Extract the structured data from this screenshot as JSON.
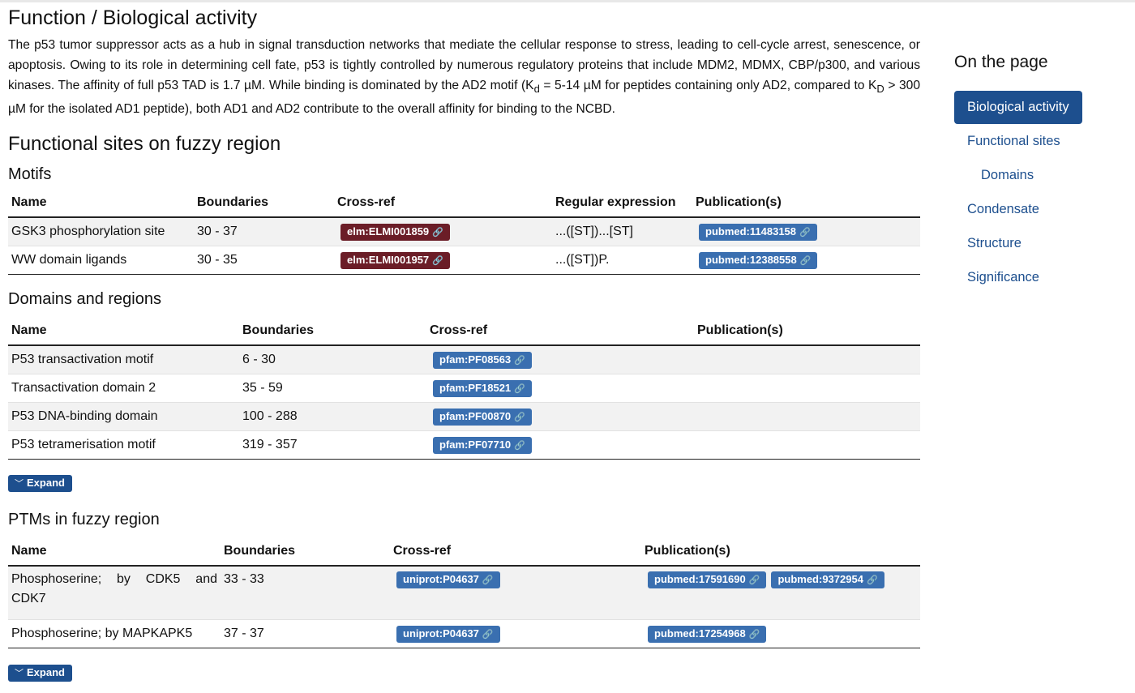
{
  "header": {
    "title": "Function / Biological activity"
  },
  "intro": {
    "part1": "The p53 tumor suppressor acts as a hub in signal transduction networks that mediate the cellular response to stress, leading to cell-cycle arrest, senescence, or apoptosis. Owing to its role in determining cell fate, p53 is tightly controlled by numerous regulatory proteins that include MDM2, MDMX, CBP/p300, and various kinases. The affinity of full p53 TAD is 1.7 µM. While binding is dominated by the AD2 motif (K",
    "sub1": "d",
    "part2": " = 5-14 µM for peptides containing only AD2, compared to K",
    "sub2": "D",
    "part3": " > 300 µM for the isolated AD1 peptide), both AD1 and AD2 contribute to the overall affinity for binding to the NCBD."
  },
  "functional_sites": {
    "title": "Functional sites on fuzzy region"
  },
  "motifs": {
    "title": "Motifs",
    "headers": {
      "name": "Name",
      "boundaries": "Boundaries",
      "crossref": "Cross-ref",
      "regex": "Regular expression",
      "publications": "Publication(s)"
    },
    "rows": [
      {
        "name": "GSK3 phosphorylation site",
        "boundaries": "30 - 37",
        "crossref": "elm:ELMI001859",
        "regex": "...([ST])...[ST]",
        "pub": "pubmed:11483158"
      },
      {
        "name": "WW domain ligands",
        "boundaries": "30 - 35",
        "crossref": "elm:ELMI001957",
        "regex": "...([ST])P.",
        "pub": "pubmed:12388558"
      }
    ]
  },
  "domains": {
    "title": "Domains and regions",
    "headers": {
      "name": "Name",
      "boundaries": "Boundaries",
      "crossref": "Cross-ref",
      "publications": "Publication(s)"
    },
    "rows": [
      {
        "name": "P53 transactivation motif",
        "boundaries": "6 - 30",
        "crossref": "pfam:PF08563"
      },
      {
        "name": "Transactivation domain 2",
        "boundaries": "35 - 59",
        "crossref": "pfam:PF18521"
      },
      {
        "name": "P53 DNA-binding domain",
        "boundaries": "100 - 288",
        "crossref": "pfam:PF00870"
      },
      {
        "name": "P53 tetramerisation motif",
        "boundaries": "319 - 357",
        "crossref": "pfam:PF07710"
      }
    ],
    "expand_label": "Expand"
  },
  "ptms": {
    "title": "PTMs in fuzzy region",
    "headers": {
      "name": "Name",
      "boundaries": "Boundaries",
      "crossref": "Cross-ref",
      "publications": "Publication(s)"
    },
    "rows": [
      {
        "name": "Phosphoserine; by CDK5 and CDK7",
        "boundaries": "33 - 33",
        "crossref": "uniprot:P04637",
        "pubs": [
          "pubmed:17591690",
          "pubmed:9372954"
        ]
      },
      {
        "name": "Phosphoserine; by MAPKAPK5",
        "boundaries": "37 - 37",
        "crossref": "uniprot:P04637",
        "pubs": [
          "pubmed:17254968"
        ]
      }
    ],
    "expand_label": "Expand"
  },
  "sidebar": {
    "title": "On the page",
    "items": [
      {
        "label": "Biological activity",
        "active": true
      },
      {
        "label": "Functional sites"
      },
      {
        "label": "Domains",
        "indent": true
      },
      {
        "label": "Condensate"
      },
      {
        "label": "Structure"
      },
      {
        "label": "Significance"
      }
    ]
  },
  "colors": {
    "accent": "#1d4f8e",
    "elm_badge": "#6b1d27",
    "ref_badge": "#3a6fb0"
  },
  "icons": {
    "link": "link-icon",
    "expand": "chevron-down-icon"
  }
}
